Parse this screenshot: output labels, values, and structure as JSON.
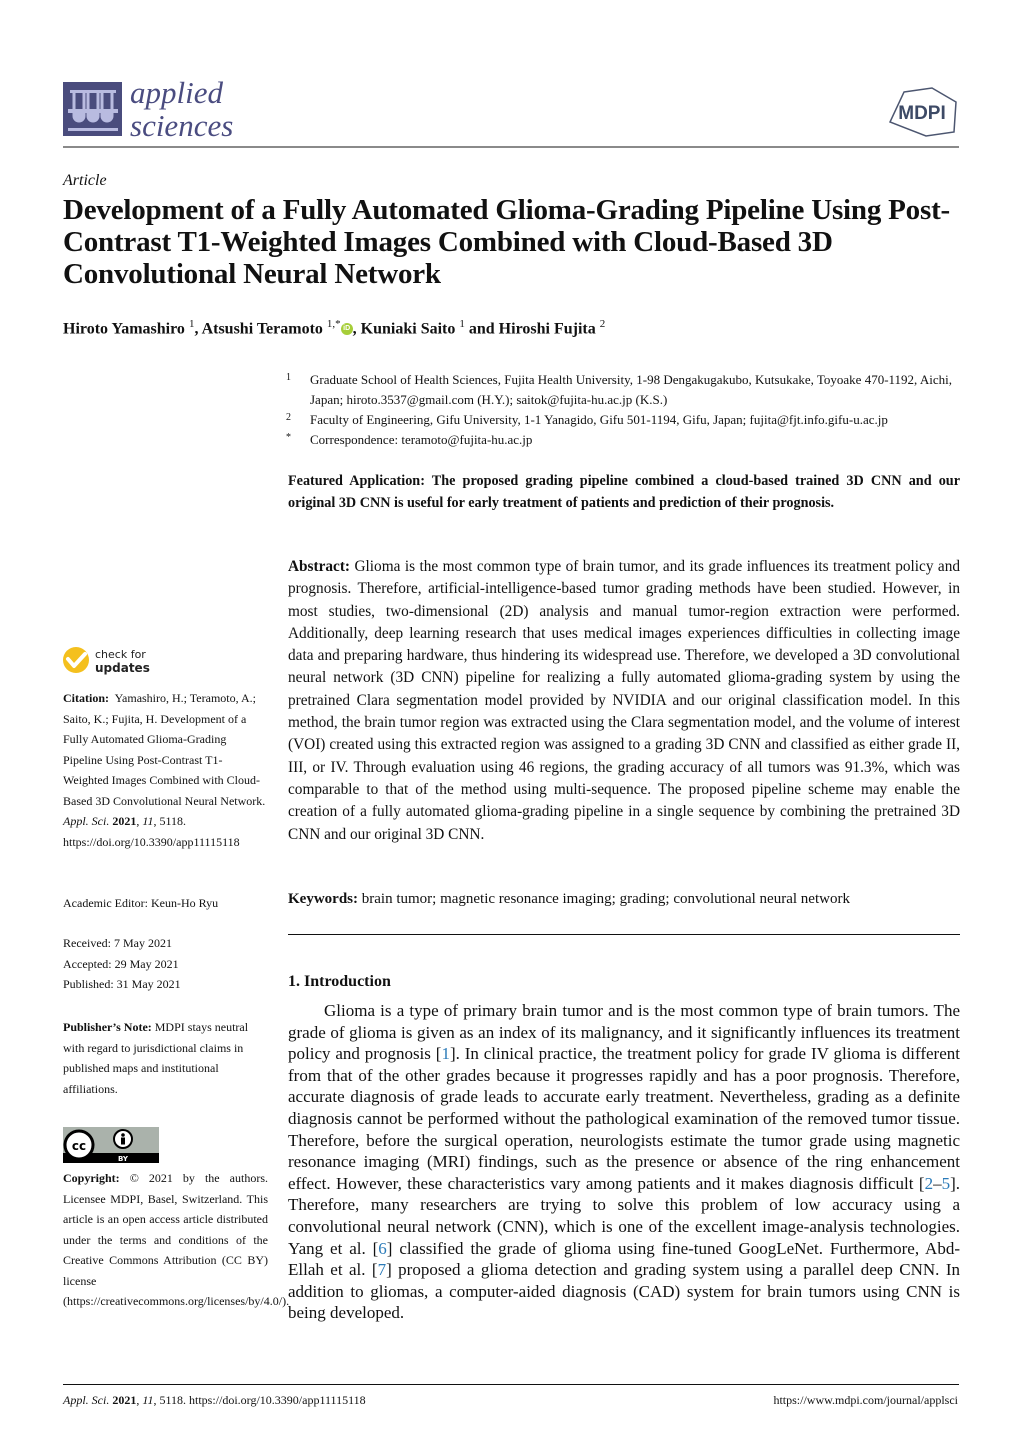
{
  "header": {
    "journal_line1": "applied",
    "journal_line2": "sciences",
    "publisher_logo": "MDPI"
  },
  "article": {
    "type": "Article",
    "title": "Development of a Fully Automated Glioma-Grading Pipeline Using Post-Contrast T1-Weighted Images Combined with Cloud-Based 3D Convolutional Neural Network",
    "authors": [
      {
        "name": "Hiroto Yamashiro",
        "sup": "1",
        "sep": ", "
      },
      {
        "name": "Atsushi Teramoto",
        "sup": "1,*",
        "sep": ", ",
        "orcid": "iD"
      },
      {
        "name": "Kuniaki Saito",
        "sup": "1",
        "sep": " and "
      },
      {
        "name": "Hiroshi Fujita",
        "sup": "2",
        "sep": ""
      }
    ],
    "affiliations": [
      {
        "num": "1",
        "text": "Graduate School of Health Sciences, Fujita Health University, 1-98 Dengakugakubo, Kutsukake, Toyoake 470-1192, Aichi, Japan; hiroto.3537@gmail.com (H.Y.); saitok@fujita-hu.ac.jp (K.S.)"
      },
      {
        "num": "2",
        "text": "Faculty of Engineering, Gifu University, 1-1 Yanagido, Gifu 501-1194, Gifu, Japan; fujita@fjt.info.gifu-u.ac.jp"
      },
      {
        "num": "*",
        "text": "Correspondence: teramoto@fujita-hu.ac.jp"
      }
    ],
    "featured_application": "Featured Application: The proposed grading pipeline combined a cloud-based trained 3D CNN and our original 3D CNN is useful for early treatment of patients and prediction of their prognosis.",
    "abstract_label": "Abstract:",
    "abstract": "Glioma is the most common type of brain tumor, and its grade influences its treatment policy and prognosis. Therefore, artificial-intelligence-based tumor grading methods have been studied. However, in most studies, two-dimensional (2D) analysis and manual tumor-region extraction were performed. Additionally, deep learning research that uses medical images experiences difficulties in collecting image data and preparing hardware, thus hindering its widespread use. Therefore, we developed a 3D convolutional neural network (3D CNN) pipeline for realizing a fully automated glioma-grading system by using the pretrained Clara segmentation model provided by NVIDIA and our original classification model. In this method, the brain tumor region was extracted using the Clara segmentation model, and the volume of interest (VOI) created using this extracted region was assigned to a grading 3D CNN and classified as either grade II, III, or IV. Through evaluation using 46 regions, the grading accuracy of all tumors was 91.3%, which was comparable to that of the method using multi-sequence. The proposed pipeline scheme may enable the creation of a fully automated glioma-grading pipeline in a single sequence by combining the pretrained 3D CNN and our original 3D CNN.",
    "keywords_label": "Keywords:",
    "keywords": "brain tumor; magnetic resonance imaging; grading; convolutional neural network"
  },
  "introduction": {
    "heading": "1. Introduction",
    "segments": [
      {
        "t": "Glioma is a type of primary brain tumor and is the most common type of brain tumors. The grade of glioma is given as an index of its malignancy, and it significantly influences its treatment policy and prognosis ["
      },
      {
        "t": "1",
        "ref": true
      },
      {
        "t": "]. In clinical practice, the treatment policy for grade IV glioma is different from that of the other grades because it progresses rapidly and has a poor prognosis. Therefore, accurate diagnosis of grade leads to accurate early treatment. Nevertheless, grading as a definite diagnosis cannot be performed without the pathological examination of the removed tumor tissue. Therefore, before the surgical operation, neurologists estimate the tumor grade using magnetic resonance imaging (MRI) findings, such as the presence or absence of the ring enhancement effect. However, these characteristics vary among patients and it makes diagnosis difficult ["
      },
      {
        "t": "2",
        "ref": true
      },
      {
        "t": "–"
      },
      {
        "t": "5",
        "ref": true
      },
      {
        "t": "]. Therefore, many researchers are trying to solve this problem of low accuracy using a convolutional neural network (CNN), which is one of the excellent image-analysis technologies. Yang et al. ["
      },
      {
        "t": "6",
        "ref": true
      },
      {
        "t": "] classified the grade of glioma using fine-tuned GoogLeNet. Furthermore, Abd-Ellah et al. ["
      },
      {
        "t": "7",
        "ref": true
      },
      {
        "t": "] proposed a glioma detection and grading system using a parallel deep CNN. In addition to gliomas, a computer-aided diagnosis (CAD) system for brain tumors using CNN is being developed."
      }
    ]
  },
  "sidebar": {
    "check_updates_line1": "check for",
    "check_updates_line2": "updates",
    "citation_label": "Citation:",
    "citation_text": "Yamashiro, H.; Teramoto, A.; Saito, K.; Fujita, H. Development of a Fully Automated Glioma-Grading Pipeline Using Post-Contrast T1-Weighted Images Combined with Cloud-Based 3D Convolutional Neural Network.",
    "citation_journal": "Appl. Sci.",
    "citation_year": "2021",
    "citation_volume": "11",
    "citation_rest": ", 5118.  https://doi.org/10.3390/app11115118",
    "academic_editor": "Academic Editor: Keun-Ho Ryu",
    "received": "Received: 7 May 2021",
    "accepted": "Accepted: 29 May 2021",
    "published": "Published: 31 May 2021",
    "publisher_note_label": "Publisher’s Note:",
    "publisher_note": "MDPI stays neutral with regard to jurisdictional claims in published maps and institutional affiliations.",
    "cc_label": "BY",
    "copyright_label": "Copyright:",
    "copyright_text": "© 2021 by the authors. Licensee MDPI, Basel, Switzerland. This article is an open access article distributed under the terms and conditions of the Creative Commons Attribution (CC BY) license (https://creativecommons.org/licenses/by/4.0/)."
  },
  "footer": {
    "journal": "Appl. Sci.",
    "year": "2021",
    "volume": "11",
    "rest": ", 5118. https://doi.org/10.3390/app11115118",
    "url": "https://www.mdpi.com/journal/applsci"
  },
  "colors": {
    "journal_brand": "#4a4c80",
    "link": "#2a7ab8",
    "check_updates": "#f4c01e",
    "orcid": "#a6ce39"
  }
}
